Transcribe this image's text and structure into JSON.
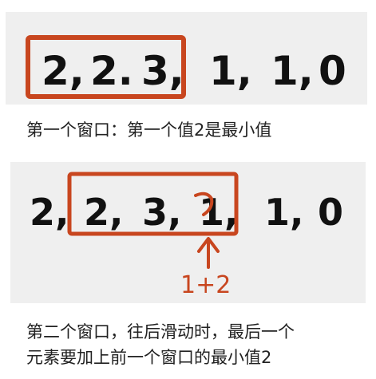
{
  "colors": {
    "panel_background": "#efefef",
    "ink": "#111111",
    "highlight": "#c8461f",
    "caption_text": "#222222"
  },
  "panel1": {
    "sequence": [
      "2,",
      "2.",
      "3,",
      "1,",
      "1,",
      "0"
    ],
    "caption": "第一个窗口：第一个值2是最小值"
  },
  "panel2": {
    "sequence": [
      "2,",
      "2,",
      "3,",
      "1,",
      "1,",
      "0"
    ],
    "arrow_note": "1+2",
    "caption_line1": "第二个窗口，往后滑动时，最后一个",
    "caption_line2": "元素要加上前一个窗口的最小值2"
  }
}
